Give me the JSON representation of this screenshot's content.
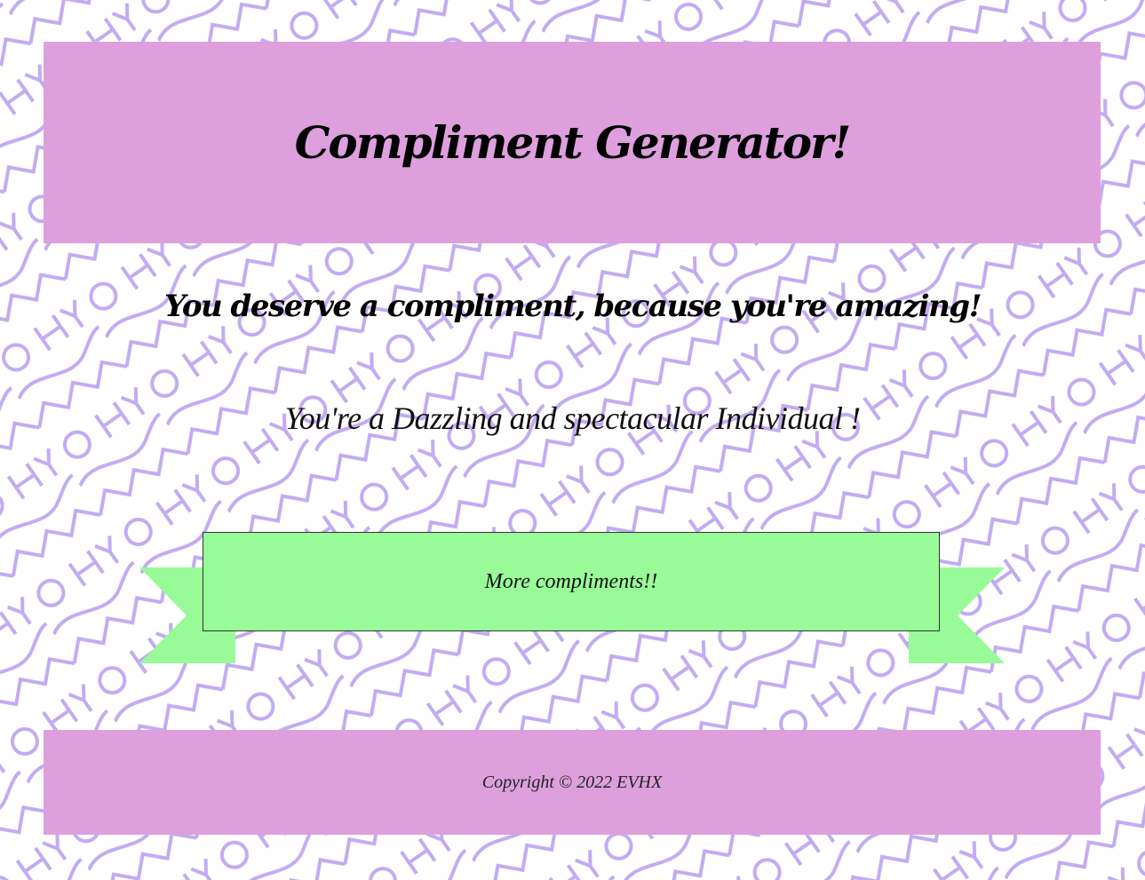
{
  "header": {
    "title": "Compliment Generator!"
  },
  "tagline": "You deserve a compliment, because you're amazing!",
  "compliment": "You're a Dazzling and spectacular Individual !",
  "button": {
    "label": "More compliments!!"
  },
  "footer": {
    "copyright": "Copyright © 2022 EVHX"
  },
  "colors": {
    "banner": "#dda0dd",
    "button": "#98fb98",
    "pattern": "#b89cf0",
    "background": "#ffffff"
  },
  "icons": {
    "background": "repeating-word-pattern"
  }
}
